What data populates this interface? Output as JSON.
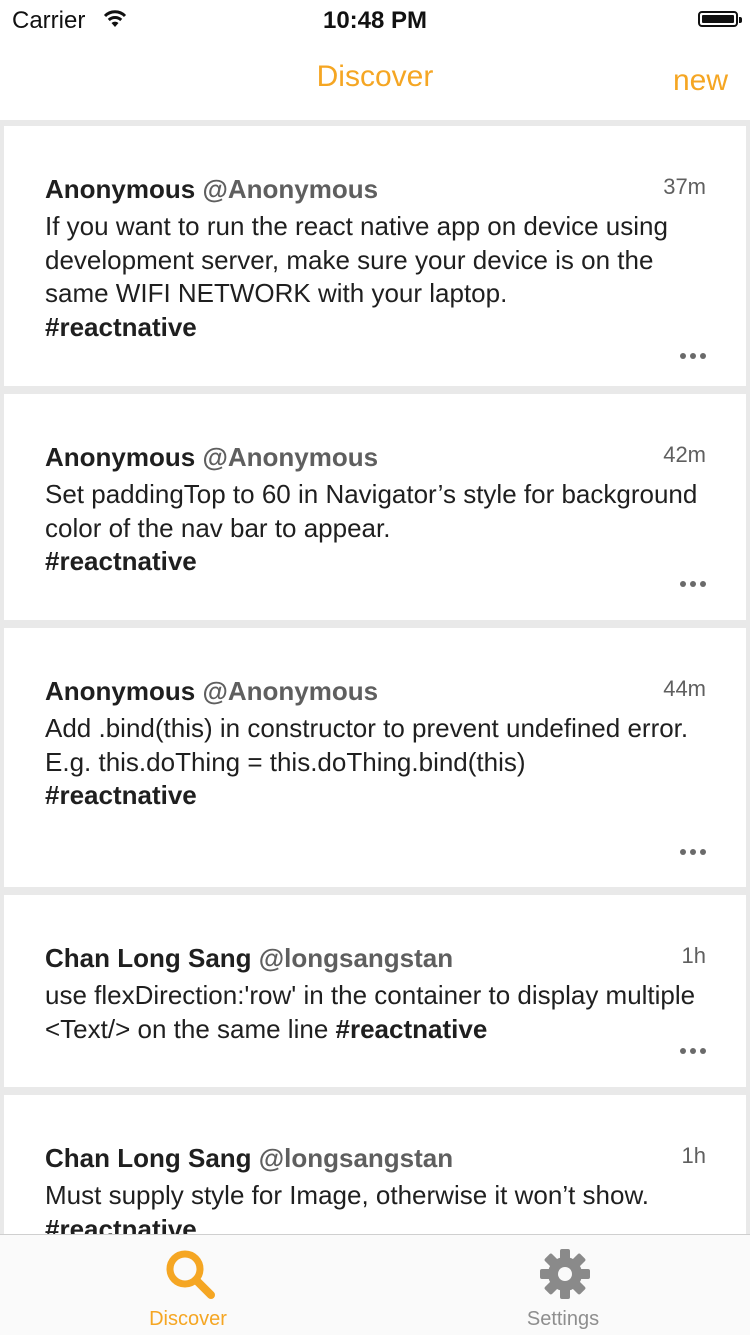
{
  "status_bar": {
    "carrier": "Carrier",
    "time": "10:48 PM"
  },
  "nav": {
    "title": "Discover",
    "new_label": "new",
    "accent_color": "#f5a623"
  },
  "posts": [
    {
      "name": "Anonymous",
      "handle": "@Anonymous",
      "time": "37m",
      "text": "If you want to run the react native app on device using development server, make sure your device is on the same WIFI NETWORK with your laptop.\n",
      "tag": "#reactnative"
    },
    {
      "name": "Anonymous",
      "handle": "@Anonymous",
      "time": "42m",
      "text": "Set paddingTop to 60 in Navigator’s style for background color of the nav bar to appear.\n",
      "tag": "#reactnative"
    },
    {
      "name": "Anonymous",
      "handle": "@Anonymous",
      "time": "44m",
      "text": "Add .bind(this) in constructor to prevent undefined error.\nE.g. this.doThing = this.doThing.bind(this)\n",
      "tag": "#reactnative"
    },
    {
      "name": "Chan Long Sang",
      "handle": "@longsangstan",
      "time": "1h",
      "text": "use flexDirection:'row' in the container to display multiple <Text/> on the same line ",
      "tag": "#reactnative"
    },
    {
      "name": "Chan Long Sang",
      "handle": "@longsangstan",
      "time": "1h",
      "text": "Must supply style for Image, otherwise it won’t show. ",
      "tag": "#reactnative"
    }
  ],
  "tabbar": {
    "tabs": [
      {
        "label": "Discover",
        "icon": "search-icon",
        "active": true
      },
      {
        "label": "Settings",
        "icon": "gear-icon",
        "active": false
      }
    ]
  }
}
